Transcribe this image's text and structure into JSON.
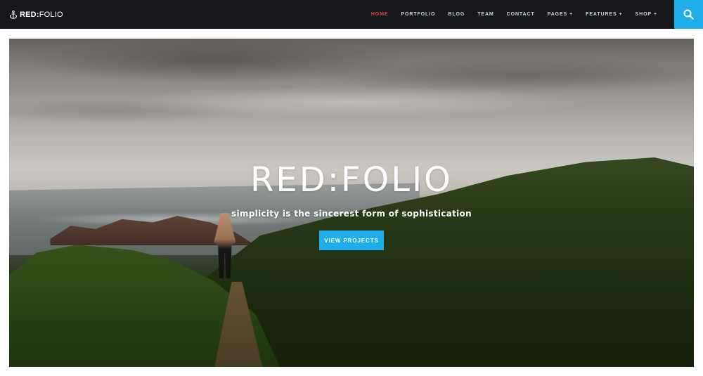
{
  "brand": {
    "logo_strong": "RED:",
    "logo_light": "FOLIO",
    "icon": "anchor-icon"
  },
  "nav": {
    "items": [
      {
        "label": "HOME",
        "active": true,
        "has_submenu": false
      },
      {
        "label": "PORTFOLIO",
        "active": false,
        "has_submenu": false
      },
      {
        "label": "BLOG",
        "active": false,
        "has_submenu": false
      },
      {
        "label": "TEAM",
        "active": false,
        "has_submenu": false
      },
      {
        "label": "CONTACT",
        "active": false,
        "has_submenu": false
      },
      {
        "label": "PAGES",
        "active": false,
        "has_submenu": true
      },
      {
        "label": "FEATURES",
        "active": false,
        "has_submenu": true
      },
      {
        "label": "SHOP",
        "active": false,
        "has_submenu": true
      }
    ],
    "submenu_marker": "+",
    "search_icon": "search-icon"
  },
  "hero": {
    "title": "RED:FOLIO",
    "subtitle": "simplicity is the sincerest form of sophistication",
    "cta_label": "VIEW PROJECTS"
  },
  "colors": {
    "header_bg": "#16181c",
    "accent_blue": "#1faee9",
    "active_nav": "#e8473c",
    "nav_text": "#cfd2d6"
  }
}
